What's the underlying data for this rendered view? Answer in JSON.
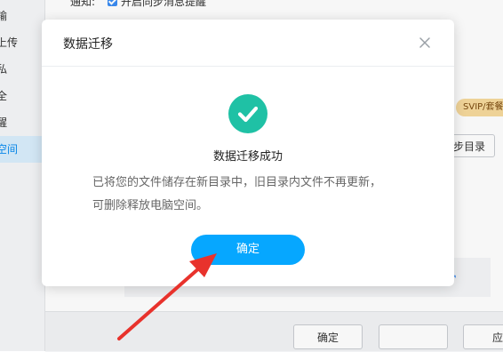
{
  "background": {
    "sidebar": {
      "items": [
        {
          "label": "输",
          "active": false
        },
        {
          "label": "上传",
          "active": false
        },
        {
          "label": "私",
          "active": false
        },
        {
          "label": "全",
          "active": false
        },
        {
          "label": "醒",
          "active": false
        },
        {
          "label": "空间",
          "active": true
        }
      ]
    },
    "notify": {
      "label": "通知:",
      "checkbox_label": "开启同步消息提醒",
      "checked": true
    },
    "svip_badge": "SVIP/套餐专",
    "sync_dir_button": "步目录",
    "footer": {
      "ok_label": "确定",
      "apply_label": "应用"
    }
  },
  "dialog": {
    "title": "数据迁移",
    "close_icon": "close-icon",
    "success_icon": "check-circle-icon",
    "success_title": "数据迁移成功",
    "description_line1": "已将您的文件储存在新目录中，旧目录内文件不再更新，",
    "description_line2": "可删除释放电脑空间。",
    "confirm_label": "确定"
  },
  "annotation": {
    "arrow_color": "#e8322c"
  },
  "colors": {
    "accent": "#06a7ff",
    "success": "#1fc1a5",
    "sidebar_active_bg": "#d9eefc"
  }
}
